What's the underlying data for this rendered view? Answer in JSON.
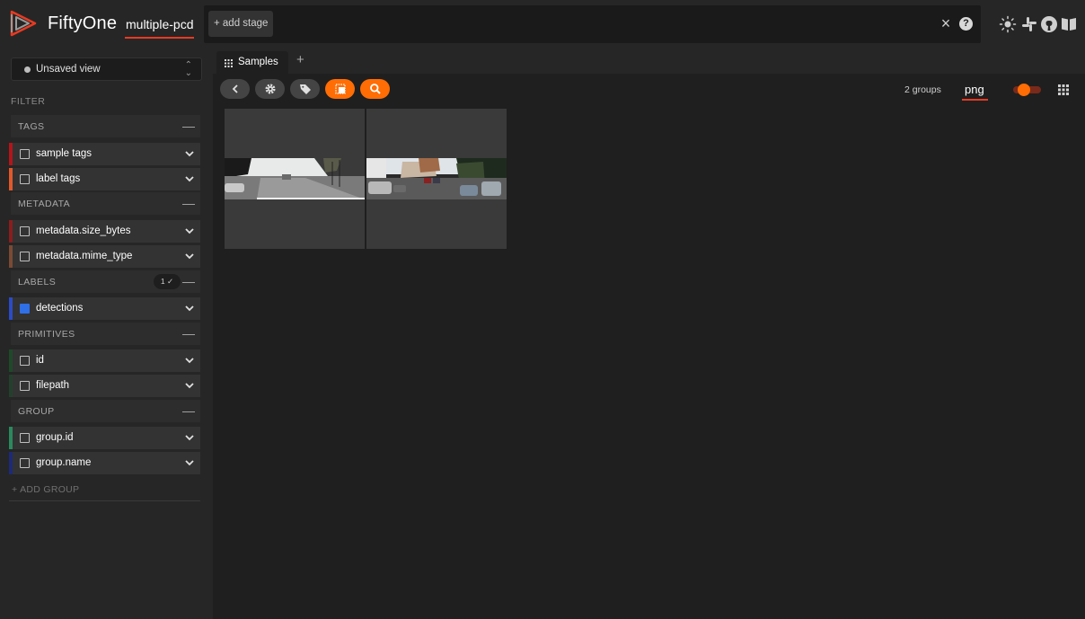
{
  "app": {
    "title": "FiftyOne",
    "dataset": "multiple-pcd"
  },
  "stage_bar": {
    "add_stage": "+ add stage",
    "clear_icon": "close-icon",
    "help_icon": "help-icon"
  },
  "top_icons": [
    "sun-icon",
    "slack-icon",
    "github-icon",
    "docs-icon"
  ],
  "sidebar": {
    "view_select": "Unsaved view",
    "filter_heading": "FILTER",
    "groups": [
      {
        "label": "TAGS",
        "fields": [
          {
            "label": "sample tags",
            "color": "#b5151a",
            "checked": false
          },
          {
            "label": "label tags",
            "color": "#e3582a",
            "checked": false
          }
        ]
      },
      {
        "label": "METADATA",
        "fields": [
          {
            "label": "metadata.size_bytes",
            "color": "#8b1d1d",
            "checked": false
          },
          {
            "label": "metadata.mime_type",
            "color": "#7a4a33",
            "checked": false
          }
        ]
      },
      {
        "label": "LABELS",
        "badge": "1 ✓",
        "fields": [
          {
            "label": "detections",
            "color": "#2b4bc7",
            "checked": true
          }
        ]
      },
      {
        "label": "PRIMITIVES",
        "fields": [
          {
            "label": "id",
            "color": "#1e4a2a",
            "checked": false
          },
          {
            "label": "filepath",
            "color": "#23402c",
            "checked": false
          }
        ]
      },
      {
        "label": "GROUP",
        "fields": [
          {
            "label": "group.id",
            "color": "#2a8a5e",
            "checked": false
          },
          {
            "label": "group.name",
            "color": "#1d2a7a",
            "checked": false
          }
        ]
      }
    ],
    "add_group": "+ ADD GROUP"
  },
  "tabs": {
    "active": "Samples"
  },
  "toolbar": {
    "buttons": [
      "back-icon",
      "settings-icon",
      "tag-icon",
      "patches-icon",
      "similarity-search-icon"
    ],
    "groups_count": "2 groups",
    "slice": "png"
  },
  "grid": {
    "thumbnails": 2
  },
  "colors": {
    "accent": "#ff6d04",
    "brand": "#e83a22"
  }
}
